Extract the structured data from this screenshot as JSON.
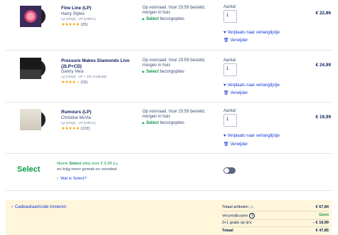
{
  "items": [
    {
      "title": "Fine Line (LP)",
      "artist": "Harry Styles",
      "format": "Lp (Vinyl) · LP (VINYL)",
      "stars": "★★★★★",
      "reviews": "(25)",
      "stock": "Op voorraad. Voor 23:59 besteld, morgen in huis",
      "select_label": "Select",
      "select_suffix": "bezorgopties",
      "qty_label": "Aantal",
      "qty": "1",
      "price": "€ 22,86",
      "wishlist": "Verplaats naar verlanglijstje",
      "remove": "Verwijder"
    },
    {
      "title": "Pressure Makes Diamonds Live (2LP+CD)",
      "artist": "Danny Vera",
      "format": "Lp (Vinyl) · LP + CD (ALBUM)",
      "stars": "★★★★☆",
      "reviews": "(15)",
      "stock": "Op voorraad. Voor 23:59 besteld, morgen in huis",
      "select_label": "Select",
      "select_suffix": "bezorgopties",
      "qty_label": "Aantal",
      "qty": "1",
      "price": "€ 24,99",
      "wishlist": "Verplaats naar verlanglijstje",
      "remove": "Verwijder"
    },
    {
      "title": "Rumours (LP)",
      "artist": "Christine McVie",
      "format": "Lp (Vinyl) · LP (VINYL)",
      "stars": "★★★★★",
      "reviews": "(122)",
      "stock": "Op voorraad. Voor 23:59 besteld, morgen in huis",
      "select_label": "Select",
      "select_suffix": "bezorgopties",
      "qty_label": "Aantal",
      "qty": "1",
      "price": "€ 19,99",
      "wishlist": "Verplaats naar verlanglijstje",
      "remove": "Verwijder"
    }
  ],
  "select_promo": {
    "logo": "Select",
    "line1_pre": "Neem",
    "line1_brand": "Select",
    "line1_post": "erbij voor € 9,99 p.j.",
    "line2": "en krijg meer gemak en voordeel",
    "link": "Wat is Select?"
  },
  "footer": {
    "gift": "Cadeaukaartcode invoeren",
    "rows": [
      {
        "label": "Totaal artikelen",
        "count": "(3)",
        "value": "€ 67,84"
      },
      {
        "label": "Verzendkosten",
        "value": "Geen"
      },
      {
        "label": "2+1 gratis op lp's",
        "value": "- € 19,99"
      },
      {
        "label": "Totaal",
        "value": "€ 47,85"
      }
    ]
  },
  "colors": {
    "select_green": "#0b9a42",
    "link_blue": "#1536d8",
    "text_navy": "#0a1e5a",
    "star": "#f5a400",
    "footer_bg": "#fff6db"
  },
  "icons": {
    "wishlist": "heart-icon",
    "remove": "trash-icon",
    "chevron": "chevron-right-icon",
    "info": "info-icon",
    "select_bullet": "triangle-right-icon"
  }
}
